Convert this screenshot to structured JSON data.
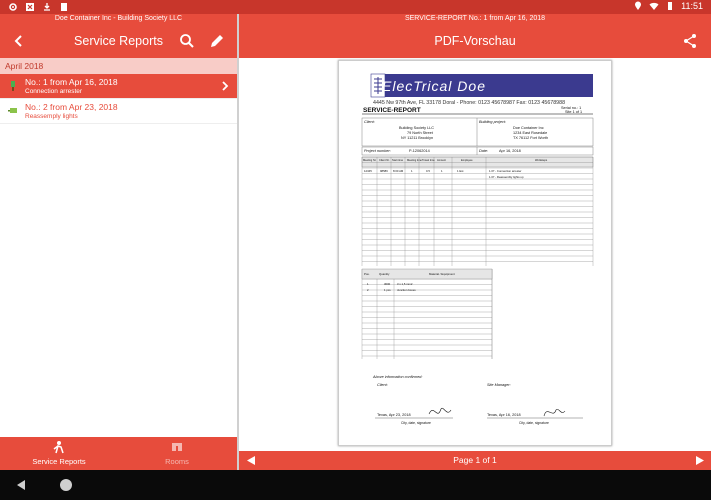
{
  "status_bar": {
    "time": "11:51",
    "left_icons": [
      "gear-icon",
      "close-icon",
      "download-icon",
      "clipboard-icon"
    ],
    "right_icons": [
      "location-icon",
      "wifi-icon",
      "battery-icon"
    ]
  },
  "left_pane": {
    "subtitle": "Doe Container Inc - Building Society LLC",
    "title": "Service Reports",
    "section": "April 2018",
    "items": [
      {
        "title": "No.: 1 from Apr 16, 2018",
        "subtitle": "Connection arrester",
        "selected": true
      },
      {
        "title": "No.: 2 from Apr 23, 2018",
        "subtitle": "Reassemply lights",
        "selected": false
      }
    ]
  },
  "right_pane": {
    "subtitle": "SERVICE-REPORT No.: 1 from Apr 16, 2018",
    "title": "PDF-Vorschau",
    "pager": "Page 1 of 1"
  },
  "bottom_nav": {
    "items": [
      {
        "label": "Service Reports",
        "active": true
      },
      {
        "label": "Rooms",
        "active": false
      }
    ]
  },
  "document": {
    "logo_text": "ElecTrical Doe",
    "address": "4445 Nw 97th Ave, FL 33178 Doral - Phone: 0123 45678987 Fax: 0123 45678988",
    "heading": "SERVICE-REPORT",
    "serial": "Serial no.: 1",
    "site": "Site 1 of 1",
    "client_label": "Client:",
    "client_lines": [
      "Building Society LLC",
      "79 North Street",
      "NY 11211 Brooklyn"
    ],
    "project_label": "Building project:",
    "project_lines": [
      "Doe Container Inc",
      "1234 East Rosedale",
      "TX 76112 Fort Worth"
    ],
    "project_number_label": "Project number:",
    "project_number": "P-12062014",
    "date_label": "Date:",
    "date": "Apr 16, 2018",
    "table1_headers": [
      "Meeting Nr.",
      "Client Nr.",
      "Start time",
      "Meeting time",
      "Travel time",
      "Amount",
      "Employee",
      "Worksteps"
    ],
    "table1_row": [
      "12345",
      "98586",
      "8:00 AM",
      "1",
      "0.5",
      "1",
      "1 Est",
      "1.07 - Connection arrester"
    ],
    "table1_row2": "1.07 - Reassembly lights up",
    "table2_headers": [
      "Pos.",
      "Quantity",
      "Material / Equipment"
    ],
    "table2_rows": [
      [
        "1",
        "3000",
        "3 x 1,5 mm2"
      ],
      [
        "2",
        "1 pcs",
        "Junction boxes"
      ]
    ],
    "confirm": "Above information confirmed:",
    "sig_client": "Client:",
    "sig_manager": "Site Manager:",
    "sig_left_date": "Texas, Apr 23, 2018",
    "sig_right_date": "Texas, Apr 16, 2018",
    "sig_caption": "City, date, signature"
  }
}
